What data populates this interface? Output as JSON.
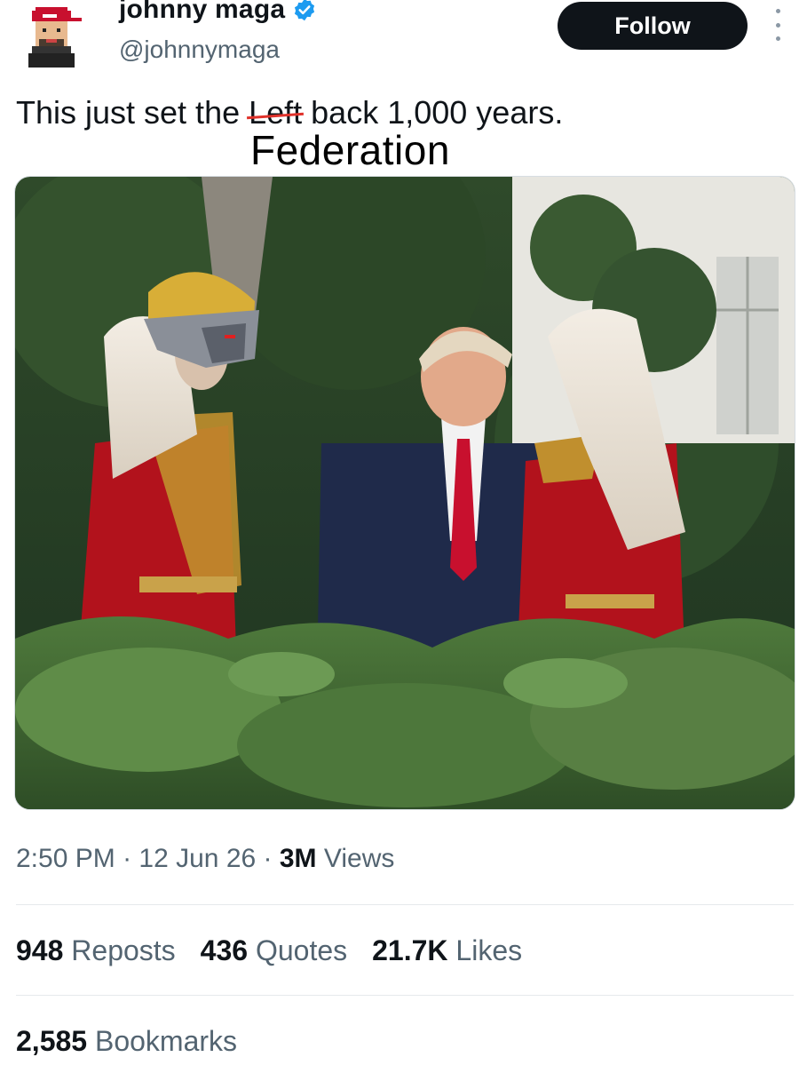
{
  "author": {
    "display_name": "johnny maga",
    "handle": "@johnnymaga",
    "avatar_icon": "pixel-maga-avatar-icon",
    "verified_icon": "verified-badge-icon"
  },
  "actions": {
    "follow_label": "Follow",
    "more_icon": "more-vertical-icon"
  },
  "tweet": {
    "text_before": "This just set the ",
    "struck_word": "Left",
    "text_after": " back 1,000 years.",
    "overlay_word": "Federation"
  },
  "meta": {
    "time": "2:50 PM",
    "sep1": " · ",
    "date": "12 Jun 26",
    "sep2": " · ",
    "views_count": "3M",
    "views_label": " Views"
  },
  "stats": {
    "reposts_count": "948",
    "reposts_label": " Reposts",
    "quotes_count": "436",
    "quotes_label": " Quotes",
    "likes_count": "21.7K",
    "likes_label": " Likes",
    "bookmarks_count": "2,585",
    "bookmarks_label": " Bookmarks"
  },
  "colors": {
    "verified_blue": "#1d9bf0",
    "follow_bg": "#0f1419",
    "secondary_text": "#536471",
    "strike_red": "#e0322b"
  }
}
